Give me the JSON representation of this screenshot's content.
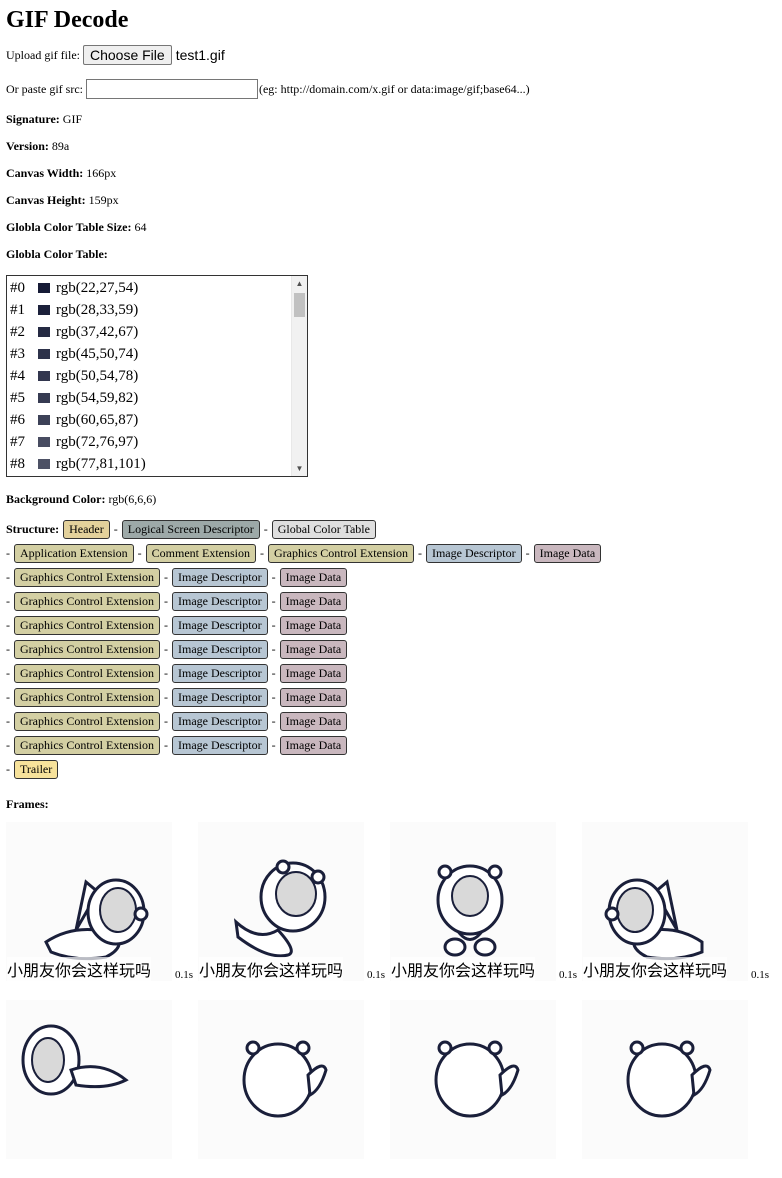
{
  "page": {
    "title": "GIF Decode",
    "upload_label": "Upload gif file:",
    "choose_file_label": "Choose File",
    "file_name": "test1.gif",
    "paste_label": "Or paste gif src:",
    "paste_value": "",
    "paste_hint": "(eg: http://domain.com/x.gif or data:image/gif;base64...)"
  },
  "info": [
    {
      "label": "Signature:",
      "value": "GIF"
    },
    {
      "label": "Version:",
      "value": "89a"
    },
    {
      "label": "Canvas Width:",
      "value": "166px"
    },
    {
      "label": "Canvas Height:",
      "value": "159px"
    },
    {
      "label": "Globla Color Table Size:",
      "value": "64"
    }
  ],
  "color_table": {
    "label": "Globla Color Table:",
    "items": [
      {
        "index": "#0",
        "rgb": "rgb(22,27,54)",
        "color": "#161b36"
      },
      {
        "index": "#1",
        "rgb": "rgb(28,33,59)",
        "color": "#1c213b"
      },
      {
        "index": "#2",
        "rgb": "rgb(37,42,67)",
        "color": "#252a43"
      },
      {
        "index": "#3",
        "rgb": "rgb(45,50,74)",
        "color": "#2d324a"
      },
      {
        "index": "#4",
        "rgb": "rgb(50,54,78)",
        "color": "#32364e"
      },
      {
        "index": "#5",
        "rgb": "rgb(54,59,82)",
        "color": "#363b52"
      },
      {
        "index": "#6",
        "rgb": "rgb(60,65,87)",
        "color": "#3c4157"
      },
      {
        "index": "#7",
        "rgb": "rgb(72,76,97)",
        "color": "#484c61"
      },
      {
        "index": "#8",
        "rgb": "rgb(77,81,101)",
        "color": "#4d5165"
      }
    ]
  },
  "background": {
    "label": "Background Color:",
    "value": "rgb(6,6,6)"
  },
  "structure": {
    "label": "Structure:",
    "separator": "-",
    "lines": [
      [
        {
          "text": "Header",
          "kind": "header"
        },
        {
          "text": "Logical Screen Descriptor",
          "kind": "lsd"
        },
        {
          "text": "Global Color Table",
          "kind": "gct"
        }
      ],
      [
        {
          "text": "Application Extension",
          "kind": "ext"
        },
        {
          "text": "Comment Extension",
          "kind": "ext"
        },
        {
          "text": "Graphics Control Extension",
          "kind": "ext"
        },
        {
          "text": "Image Descriptor",
          "kind": "img"
        },
        {
          "text": "Image Data",
          "kind": "data"
        }
      ],
      [
        {
          "text": "Graphics Control Extension",
          "kind": "ext"
        },
        {
          "text": "Image Descriptor",
          "kind": "img"
        },
        {
          "text": "Image Data",
          "kind": "data"
        }
      ],
      [
        {
          "text": "Graphics Control Extension",
          "kind": "ext"
        },
        {
          "text": "Image Descriptor",
          "kind": "img"
        },
        {
          "text": "Image Data",
          "kind": "data"
        }
      ],
      [
        {
          "text": "Graphics Control Extension",
          "kind": "ext"
        },
        {
          "text": "Image Descriptor",
          "kind": "img"
        },
        {
          "text": "Image Data",
          "kind": "data"
        }
      ],
      [
        {
          "text": "Graphics Control Extension",
          "kind": "ext"
        },
        {
          "text": "Image Descriptor",
          "kind": "img"
        },
        {
          "text": "Image Data",
          "kind": "data"
        }
      ],
      [
        {
          "text": "Graphics Control Extension",
          "kind": "ext"
        },
        {
          "text": "Image Descriptor",
          "kind": "img"
        },
        {
          "text": "Image Data",
          "kind": "data"
        }
      ],
      [
        {
          "text": "Graphics Control Extension",
          "kind": "ext"
        },
        {
          "text": "Image Descriptor",
          "kind": "img"
        },
        {
          "text": "Image Data",
          "kind": "data"
        }
      ],
      [
        {
          "text": "Graphics Control Extension",
          "kind": "ext"
        },
        {
          "text": "Image Descriptor",
          "kind": "img"
        },
        {
          "text": "Image Data",
          "kind": "data"
        }
      ],
      [
        {
          "text": "Graphics Control Extension",
          "kind": "ext"
        },
        {
          "text": "Image Descriptor",
          "kind": "img"
        },
        {
          "text": "Image Data",
          "kind": "data"
        }
      ],
      [
        {
          "text": "Trailer",
          "kind": "trailer"
        }
      ]
    ]
  },
  "frames": {
    "label": "Frames:",
    "items": [
      {
        "caption": "小朋友你会这样玩吗",
        "delay": "0.1s",
        "pose": "lie-right"
      },
      {
        "caption": "小朋友你会这样玩吗",
        "delay": "0.1s",
        "pose": "sit-right"
      },
      {
        "caption": "小朋友你会这样玩吗",
        "delay": "0.1s",
        "pose": "front"
      },
      {
        "caption": "小朋友你会这样玩吗",
        "delay": "0.1s",
        "pose": "lie-left"
      },
      {
        "caption": "",
        "delay": "",
        "pose": "roll"
      },
      {
        "caption": "",
        "delay": "",
        "pose": "back"
      },
      {
        "caption": "",
        "delay": "",
        "pose": "back"
      },
      {
        "caption": "",
        "delay": "",
        "pose": "back"
      }
    ]
  }
}
